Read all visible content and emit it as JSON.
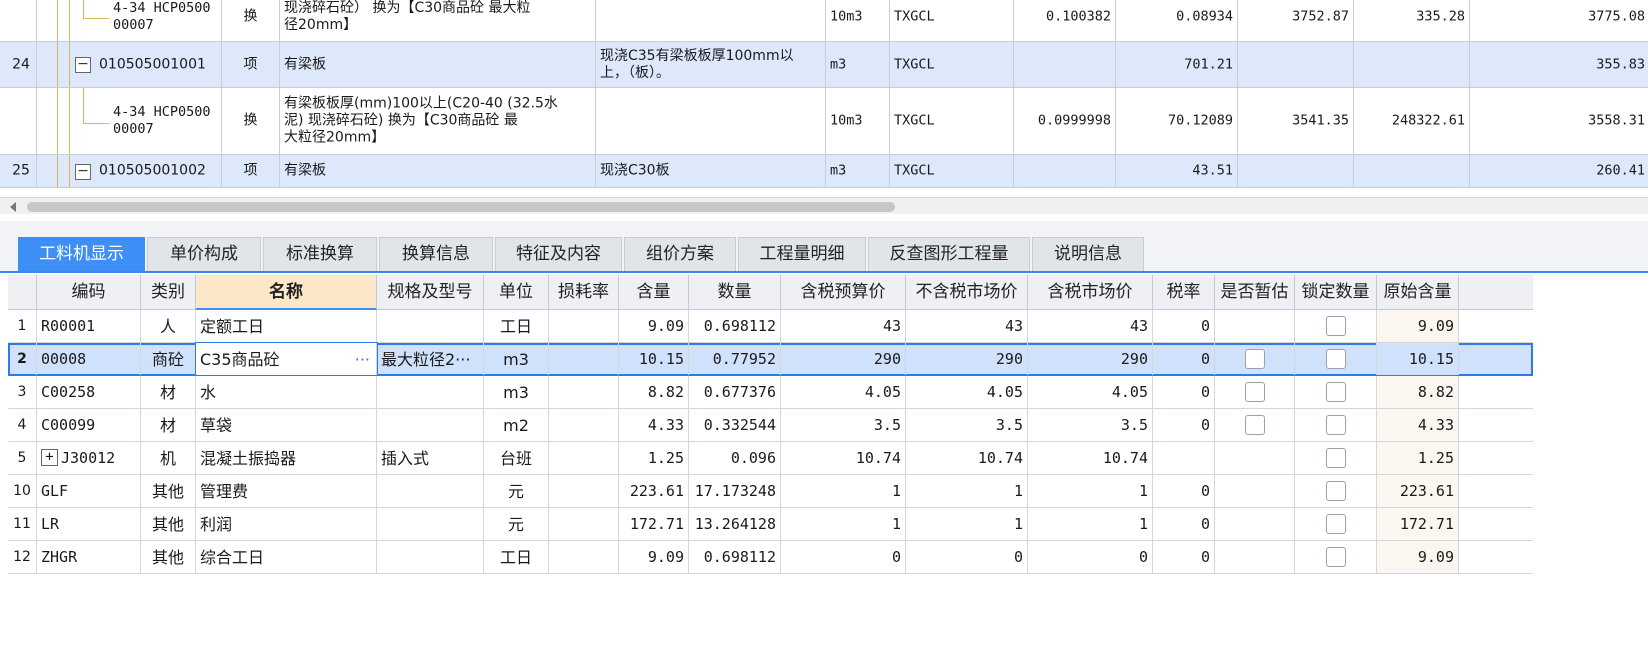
{
  "top_table": {
    "rows": [
      {
        "kind": "sub",
        "num": "",
        "code": "4-34 HCP0500\n00007",
        "type": "换",
        "name": "现浇碎石砼） 换为【C30商品砼 最大粒\n径20mm】",
        "feature": "",
        "unit": "10m3",
        "expr": "TXGCL",
        "content": "0.100382",
        "qty": "0.08934",
        "price": "3752.87",
        "total": "335.28",
        "last": "3775.08"
      },
      {
        "kind": "item",
        "num": "24",
        "code": "010505001001",
        "type": "项",
        "name": "有梁板",
        "feature": "现浇C35有梁板板厚100mm以\n上，（板）。",
        "unit": "m3",
        "expr": "TXGCL",
        "content": "",
        "qty": "701.21",
        "price": "",
        "total": "",
        "last": "355.83"
      },
      {
        "kind": "sub",
        "num": "",
        "code": "4-34 HCP0500\n00007",
        "type": "换",
        "name": "有梁板板厚(mm)100以上(C20-40 (32.5水\n泥) 现浇碎石砼) 换为【C30商品砼 最\n大粒径20mm】",
        "feature": "",
        "unit": "10m3",
        "expr": "TXGCL",
        "content": "0.0999998",
        "qty": "70.12089",
        "price": "3541.35",
        "total": "248322.61",
        "last": "3558.31"
      },
      {
        "kind": "item",
        "num": "25",
        "code": "010505001002",
        "type": "项",
        "name": "有梁板",
        "feature": "现浇C30板",
        "unit": "m3",
        "expr": "TXGCL",
        "content": "",
        "qty": "43.51",
        "price": "",
        "total": "",
        "last": "260.41"
      }
    ]
  },
  "tabs": [
    {
      "label": "工料机显示",
      "active": true
    },
    {
      "label": "单价构成"
    },
    {
      "label": "标准换算"
    },
    {
      "label": "换算信息"
    },
    {
      "label": "特征及内容"
    },
    {
      "label": "组价方案"
    },
    {
      "label": "工程量明细"
    },
    {
      "label": "反查图形工程量"
    },
    {
      "label": "说明信息"
    }
  ],
  "bottom_table": {
    "headers": [
      "编码",
      "类别",
      "名称",
      "规格及型号",
      "单位",
      "损耗率",
      "含量",
      "数量",
      "含税预算价",
      "不含税市场价",
      "含税市场价",
      "税率",
      "是否暂估",
      "锁定数量",
      "原始含量"
    ],
    "rows": [
      {
        "idx": "1",
        "code": "R00001",
        "cat": "人",
        "name": "定额工日",
        "spec": "",
        "unit": "工日",
        "loss": "",
        "content": "9.09",
        "qty": "0.698112",
        "p1": "43",
        "p2": "43",
        "p3": "43",
        "tax": "0",
        "est": false,
        "lock": true,
        "orig": "9.09"
      },
      {
        "idx": "2",
        "code": "00008",
        "cat": "商砼",
        "name": "C35商品砼",
        "spec": "最大粒径2···",
        "unit": "m3",
        "loss": "",
        "content": "10.15",
        "qty": "0.77952",
        "p1": "290",
        "p2": "290",
        "p3": "290",
        "tax": "0",
        "est": true,
        "lock": true,
        "orig": "10.15",
        "selected": true
      },
      {
        "idx": "3",
        "code": "C00258",
        "cat": "材",
        "name": "水",
        "spec": "",
        "unit": "m3",
        "loss": "",
        "content": "8.82",
        "qty": "0.677376",
        "p1": "4.05",
        "p2": "4.05",
        "p3": "4.05",
        "tax": "0",
        "est": true,
        "lock": true,
        "orig": "8.82"
      },
      {
        "idx": "4",
        "code": "C00099",
        "cat": "材",
        "name": "草袋",
        "spec": "",
        "unit": "m2",
        "loss": "",
        "content": "4.33",
        "qty": "0.332544",
        "p1": "3.5",
        "p2": "3.5",
        "p3": "3.5",
        "tax": "0",
        "est": true,
        "lock": true,
        "orig": "4.33"
      },
      {
        "idx": "5",
        "code": "J30012",
        "cat": "机",
        "name": "混凝土振捣器",
        "spec": "插入式",
        "unit": "台班",
        "loss": "",
        "content": "1.25",
        "qty": "0.096",
        "p1": "10.74",
        "p2": "10.74",
        "p3": "10.74",
        "tax": "",
        "est": false,
        "lock": true,
        "orig": "1.25",
        "expandable": true
      },
      {
        "idx": "10",
        "code": "GLF",
        "cat": "其他",
        "name": "管理费",
        "spec": "",
        "unit": "元",
        "loss": "",
        "content": "223.61",
        "qty": "17.173248",
        "p1": "1",
        "p2": "1",
        "p3": "1",
        "tax": "0",
        "est": false,
        "lock": true,
        "orig": "223.61"
      },
      {
        "idx": "11",
        "code": "LR",
        "cat": "其他",
        "name": "利润",
        "spec": "",
        "unit": "元",
        "loss": "",
        "content": "172.71",
        "qty": "13.264128",
        "p1": "1",
        "p2": "1",
        "p3": "1",
        "tax": "0",
        "est": false,
        "lock": true,
        "orig": "172.71"
      },
      {
        "idx": "12",
        "code": "ZHGR",
        "cat": "其他",
        "name": "综合工日",
        "spec": "",
        "unit": "工日",
        "loss": "",
        "content": "9.09",
        "qty": "0.698112",
        "p1": "0",
        "p2": "0",
        "p3": "0",
        "tax": "0",
        "est": false,
        "lock": true,
        "orig": "9.09"
      }
    ]
  }
}
